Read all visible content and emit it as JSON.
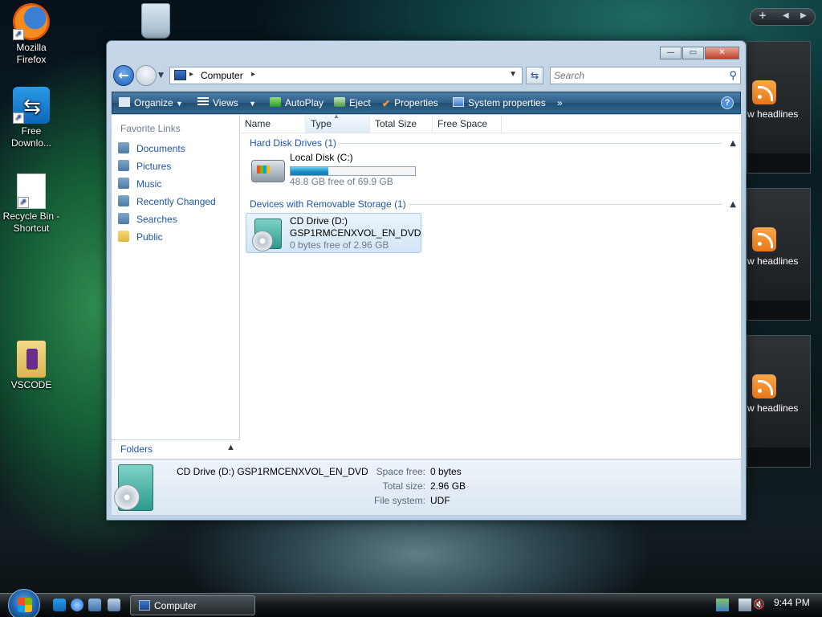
{
  "desktop": {
    "icons": [
      {
        "label": "Mozilla Firefox",
        "line1": "Mozilla",
        "line2": "Firefox"
      },
      {
        "label": "Free Downlo...",
        "line1": "Free",
        "line2": "Downlo..."
      },
      {
        "label": "Recycle Bin - Shortcut",
        "line1": "Recycle Bin -",
        "line2": "Shortcut"
      },
      {
        "label": "VSCODE",
        "line1": "VSCODE",
        "line2": ""
      }
    ]
  },
  "gadgets": {
    "controls": {
      "add": "+",
      "prev": "◀",
      "next": "▶"
    },
    "feeds": [
      {
        "label": "w headlines"
      },
      {
        "label": "w headlines"
      },
      {
        "label": "w headlines"
      }
    ]
  },
  "window": {
    "controls": {
      "minimize": "—",
      "maximize": "▭",
      "close": "✕"
    },
    "address": {
      "path": "Computer",
      "separator": "▸"
    },
    "search": {
      "placeholder": "Search"
    },
    "toolbar": {
      "organize": "Organize",
      "views": "Views",
      "autoplay": "AutoPlay",
      "eject": "Eject",
      "properties": "Properties",
      "system_properties": "System properties",
      "more": "»",
      "help": "?"
    },
    "nav_pane": {
      "title": "Favorite Links",
      "items": [
        {
          "label": "Documents",
          "icon": "documents-icon"
        },
        {
          "label": "Pictures",
          "icon": "pictures-icon"
        },
        {
          "label": "Music",
          "icon": "music-icon"
        },
        {
          "label": "Recently Changed",
          "icon": "recently-changed-icon"
        },
        {
          "label": "Searches",
          "icon": "searches-icon"
        },
        {
          "label": "Public",
          "icon": "folder-icon"
        }
      ],
      "folders_label": "Folders"
    },
    "columns": [
      "Name",
      "Type",
      "Total Size",
      "Free Space"
    ],
    "groups": [
      {
        "title": "Hard Disk Drives (1)",
        "items": [
          {
            "name": "Local Disk (C:)",
            "free_text": "48.8 GB free of 69.9 GB",
            "used_fraction": 0.302
          }
        ]
      },
      {
        "title": "Devices with Removable Storage (1)",
        "items": [
          {
            "name": "CD Drive (D:)",
            "label": "GSP1RMCENXVOL_EN_DVD",
            "free_text": "0 bytes free of 2.96 GB"
          }
        ]
      }
    ],
    "details": {
      "name": "CD Drive (D:) GSP1RMCENXVOL_EN_DVD",
      "space_free_label": "Space free:",
      "space_free": "0 bytes",
      "total_size_label": "Total size:",
      "total_size": "2.96 GB",
      "file_system_label": "File system:",
      "file_system": "UDF"
    }
  },
  "taskbar": {
    "active_window": "Computer",
    "clock": "9:44 PM"
  },
  "colors": {
    "link_blue": "#1e55a6",
    "toolbar_blue": "#2e5f8a",
    "progress_blue": "#1d8fc9"
  }
}
